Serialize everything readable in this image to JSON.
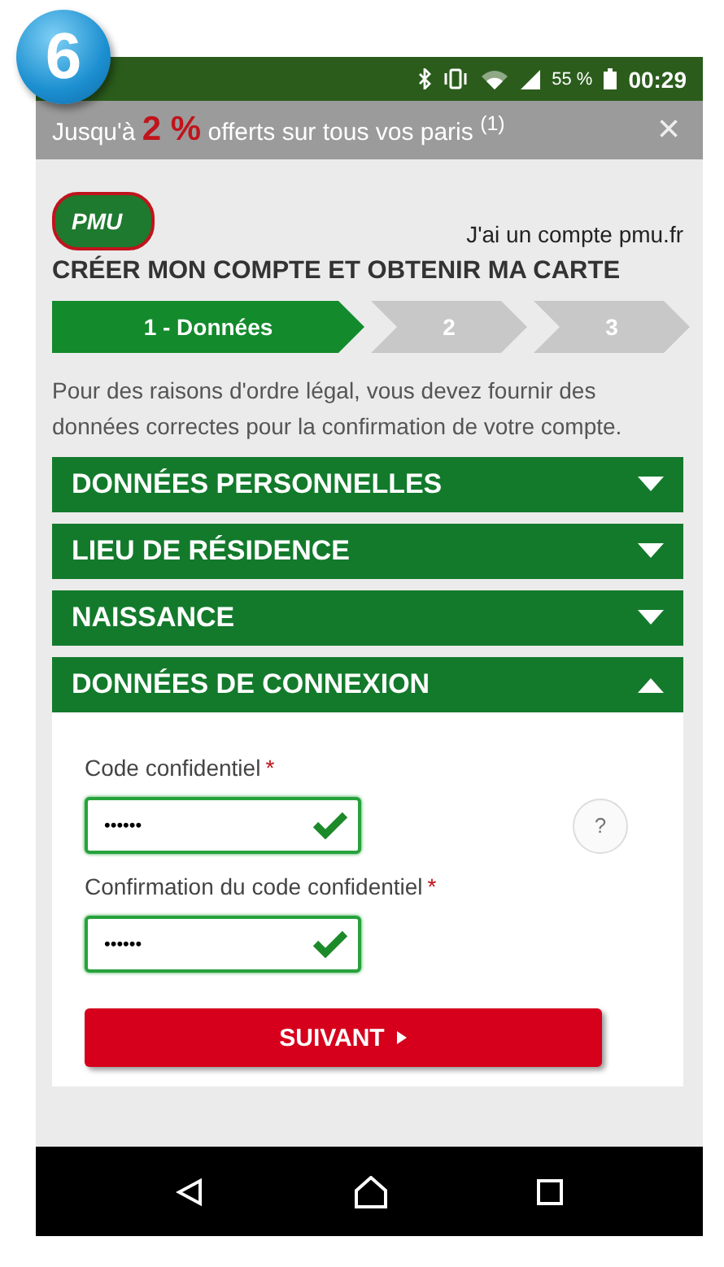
{
  "step_badge": "6",
  "status_bar": {
    "battery_text": "55 %",
    "time": "00:29"
  },
  "promo_banner": {
    "text": "Jusqu'à **2 %** offerts sur tous vos paris $^{(1)}$",
    "close": "×"
  },
  "header": {
    "logo": "PMU",
    "login_link": "J'ai un compte pmu.fr",
    "title": "CRÉER MON COMPTE ET OBTENIR MA CARTE"
  },
  "steps": [
    {
      "label": "1 - Données",
      "selected": true
    },
    {
      "label": "2",
      "selected": false
    },
    {
      "label": "3",
      "selected": false
    }
  ],
  "intro": "Pour des raisons d'ordre légal, vous devez fournir des données correctes pour la confirmation de votre compte.",
  "sections": [
    {
      "title": "DONNÉES PERSONNELLES",
      "expanded": false
    },
    {
      "title": "LIEU DE RÉSIDENCE",
      "expanded": false
    },
    {
      "title": "NAISSANCE",
      "expanded": false
    },
    {
      "title": "DONNÉES DE CONNEXION",
      "expanded": true,
      "fields": [
        {
          "label": "Code confidentiel",
          "required": true,
          "required_mark": "*",
          "value": "••••••",
          "valid": true,
          "help": "?"
        },
        {
          "label": "Confirmation du code confidentiel",
          "required": true,
          "required_mark": "*",
          "value": "••••••",
          "valid": true
        }
      ],
      "button": "SUIVANT"
    }
  ]
}
